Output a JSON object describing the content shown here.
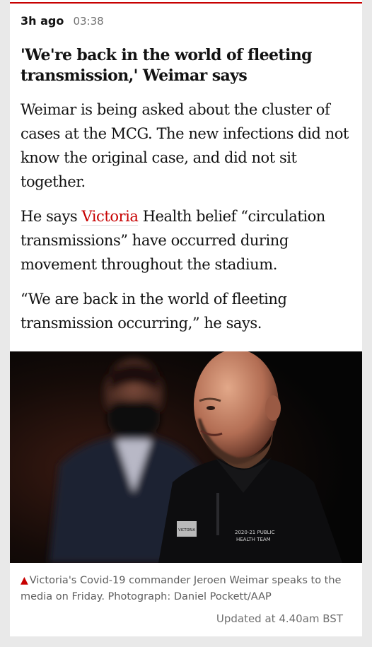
{
  "entry": {
    "relative_time": "3h ago",
    "timestamp": "03:38",
    "headline": "'We're back in the world of fleeting transmission,' Weimar says",
    "paragraphs": [
      "Weimar is being asked about the cluster of cases at the MCG. The new infections did not know the original case, and did not sit together.",
      "“We are back in the world of fleeting transmission occurring,” he says."
    ],
    "paragraph2": {
      "before_link": "He says ",
      "link_text": "Victoria",
      "after_link": " Health belief “circulation transmissions” have occurred during movement throughout the stadium."
    },
    "photo": {
      "jacket_logo": "VICTORIA",
      "jacket_text_line1": "2020-21 PUBLIC",
      "jacket_text_line2": "HEALTH TEAM"
    },
    "caption": "Victoria's Covid-19 commander Jeroen Weimar speaks to the media on Friday. Photograph: Daniel Pockett/AAP",
    "updated": "Updated at 4.40am BST"
  },
  "colors": {
    "accent_red": "#c70000",
    "background": "#e9e9e9",
    "card": "#ffffff",
    "meta_grey": "#707070"
  },
  "icons": {
    "caption_marker": "red-triangle-icon"
  }
}
